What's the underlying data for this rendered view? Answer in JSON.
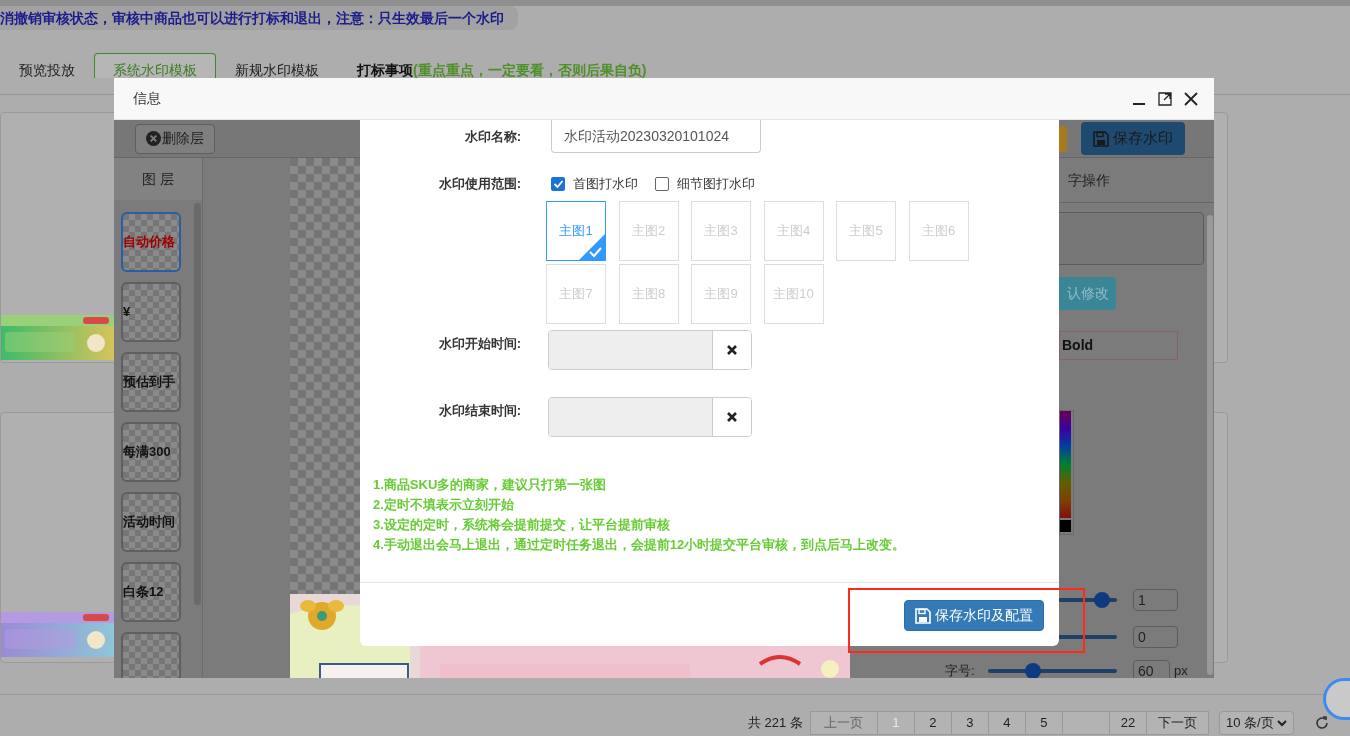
{
  "notice": "消撤销审核状态，审核中商品也可以进行打标和退出，注意：只生效最后一个水印",
  "tabs": [
    {
      "label": "预览投放",
      "selected": false
    },
    {
      "label": "系统水印模板",
      "selected": true
    },
    {
      "label": "新规水印模板",
      "selected": false
    },
    {
      "label": "打标事项",
      "note": "(重点重点，一定要看，否则后果自负)",
      "selected": false
    }
  ],
  "dialog": {
    "title": "信息"
  },
  "editor": {
    "delete_layer_button": "删除层",
    "save_button": "保存水印",
    "layers_title": "图 层",
    "layers": [
      {
        "label": "自动价格",
        "selected": true
      },
      {
        "label": "¥",
        "selected": false
      },
      {
        "label": "预估到手",
        "selected": false
      },
      {
        "label": "每满300",
        "selected": false
      },
      {
        "label": "活动时间",
        "selected": false
      },
      {
        "label": "白条12",
        "selected": false
      },
      {
        "selected": false
      }
    ]
  },
  "text_panel": {
    "title": "字操作",
    "confirm_button": "认修改",
    "font_weight": "Bold",
    "sliders": [
      {
        "level": 0.94,
        "value": "1"
      },
      {
        "value": "0"
      },
      {
        "label": "字号:",
        "level": 0.33,
        "value": "60",
        "unit": "px"
      }
    ]
  },
  "form": {
    "name_label": "水印名称:",
    "name_value": "水印活动20230320101024",
    "scope_label": "水印使用范围:",
    "scope_options": [
      {
        "label": "首图打水印",
        "checked": true
      },
      {
        "label": "细节图打水印",
        "checked": false
      }
    ],
    "images": [
      {
        "label": "主图1",
        "selected": true
      },
      {
        "label": "主图2",
        "selected": false
      },
      {
        "label": "主图3",
        "selected": false
      },
      {
        "label": "主图4",
        "selected": false
      },
      {
        "label": "主图5",
        "selected": false
      },
      {
        "label": "主图6",
        "selected": false
      },
      {
        "label": "主图7",
        "selected": false
      },
      {
        "label": "主图8",
        "selected": false
      },
      {
        "label": "主图9",
        "selected": false
      },
      {
        "label": "主图10",
        "selected": false
      }
    ],
    "start_label": "水印开始时间:",
    "end_label": "水印结束时间:",
    "notes": [
      "1.商品SKU多的商家，建议只打第一张图",
      "2.定时不填表示立刻开始",
      "3.设定的定时，系统将会提前提交，让平台提前审核",
      "4.手动退出会马上退出，通过定时任务退出，会提前12小时提交平台审核，到点后马上改变。"
    ],
    "save_button": "保存水印及配置"
  },
  "pagination": {
    "total": "共 221 条",
    "prev": "上一页",
    "pages": [
      {
        "kind": "page",
        "label": "1",
        "selected": true
      },
      {
        "kind": "page",
        "label": "2",
        "selected": false
      },
      {
        "kind": "page",
        "label": "3",
        "selected": false
      },
      {
        "kind": "page",
        "label": "4",
        "selected": false
      },
      {
        "kind": "page",
        "label": "5",
        "selected": false
      },
      {
        "kind": "gap"
      },
      {
        "kind": "page",
        "label": "22",
        "selected": false
      }
    ],
    "next": "下一页",
    "page_size": "10 条/页"
  }
}
